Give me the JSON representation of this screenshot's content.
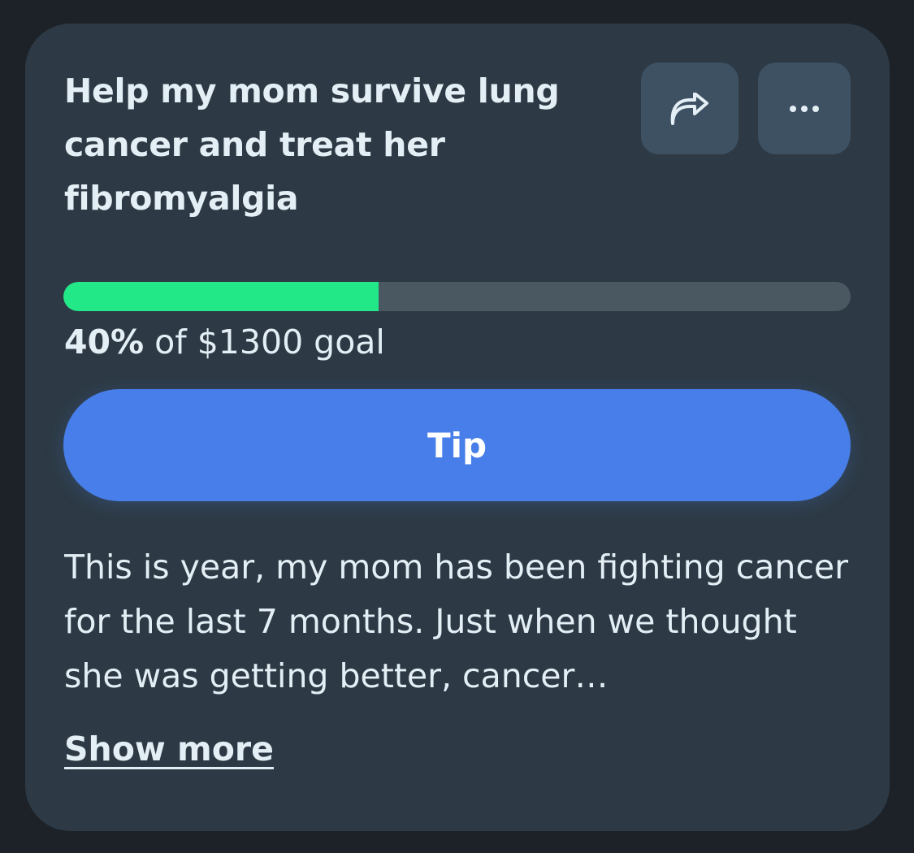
{
  "campaign": {
    "title": "Help my mom survive lung cancer and treat her fibromyalgia",
    "progress_fraction": 0.4,
    "progress_percent": "40%",
    "goal_text": " of $1300 goal",
    "description": "This is year, my mom has been fighting cancer for the last 7 months. Just when we thought she was getting better, cancer…"
  },
  "actions": {
    "share_icon": "share-arrow-icon",
    "more_icon": "more-horizontal-icon",
    "tip_label": "Tip",
    "show_more_label": "Show more"
  },
  "colors": {
    "page_background": "#1c2228",
    "card_background": "#2d3a45",
    "icon_button_background": "#3d5163",
    "progress_fill": "#22e887",
    "progress_track": "#4a5861",
    "tip_button": "#477ee9",
    "text": "#e4eef5"
  }
}
